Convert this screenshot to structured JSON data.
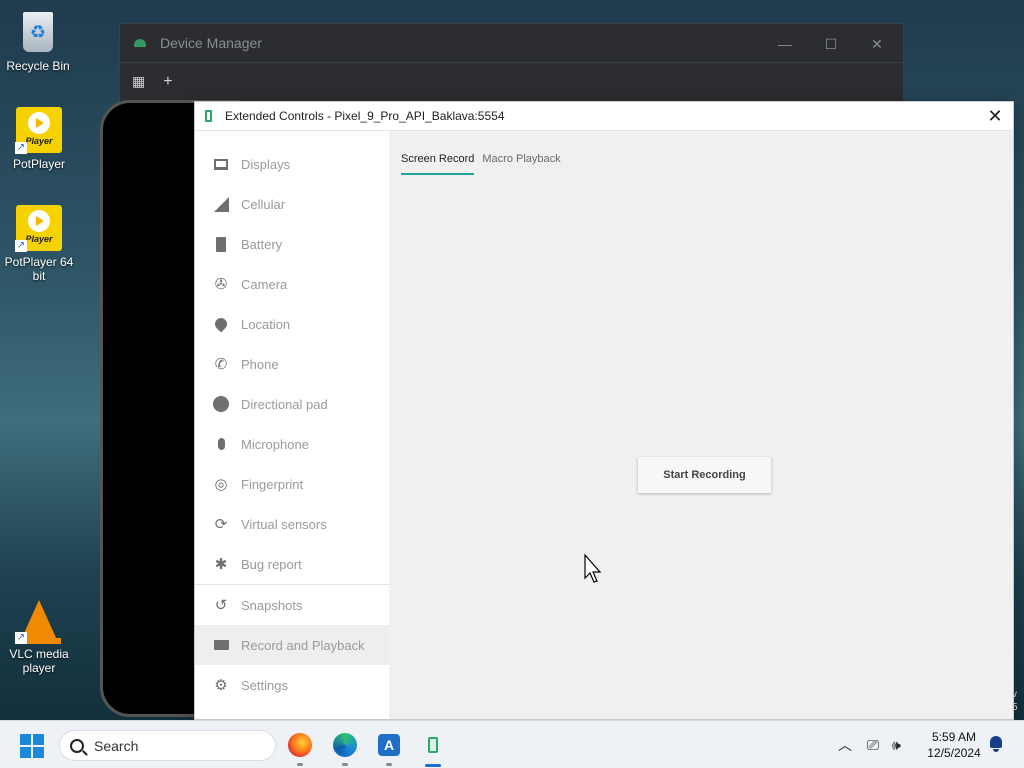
{
  "desktop": {
    "icons": [
      {
        "label": "Recycle Bin",
        "icon": "recycle-bin-icon"
      },
      {
        "label": "PotPlayer",
        "icon": "potplayer-icon",
        "badge": "Player"
      },
      {
        "label": "PotPlayer 64 bit",
        "icon": "potplayer-icon",
        "badge": "Player"
      },
      {
        "label": "VLC media player",
        "icon": "vlc-icon"
      }
    ]
  },
  "device_manager": {
    "title": "Device Manager",
    "toolbar": {
      "add": "+"
    }
  },
  "extended_controls": {
    "title": "Extended Controls - Pixel_9_Pro_API_Baklava:5554",
    "close": "✕",
    "nav": [
      {
        "label": "Displays",
        "icon": "monitor-icon"
      },
      {
        "label": "Cellular",
        "icon": "signal-icon"
      },
      {
        "label": "Battery",
        "icon": "battery-icon"
      },
      {
        "label": "Camera",
        "icon": "camera-aperture-icon"
      },
      {
        "label": "Location",
        "icon": "location-pin-icon"
      },
      {
        "label": "Phone",
        "icon": "phone-icon"
      },
      {
        "label": "Directional pad",
        "icon": "dpad-icon"
      },
      {
        "label": "Microphone",
        "icon": "microphone-icon"
      },
      {
        "label": "Fingerprint",
        "icon": "fingerprint-icon"
      },
      {
        "label": "Virtual sensors",
        "icon": "rotate-sensor-icon"
      },
      {
        "label": "Bug report",
        "icon": "bug-icon"
      },
      {
        "label": "Snapshots",
        "icon": "history-icon"
      },
      {
        "label": "Record and Playback",
        "icon": "video-camera-icon",
        "selected": true
      },
      {
        "label": "Settings",
        "icon": "gear-icon"
      }
    ],
    "tabs": [
      {
        "label": "Screen Record",
        "active": true
      },
      {
        "label": "Macro Playback",
        "active": false
      }
    ],
    "start_button": "Start Recording",
    "accent_color": "#1fa39a"
  },
  "taskbar": {
    "search_placeholder": "Search",
    "apps": [
      "firefox-icon",
      "edge-icon",
      "android-studio-icon",
      "emulator-icon"
    ],
    "time": "5:59 AM",
    "date": "12/5/2024"
  }
}
